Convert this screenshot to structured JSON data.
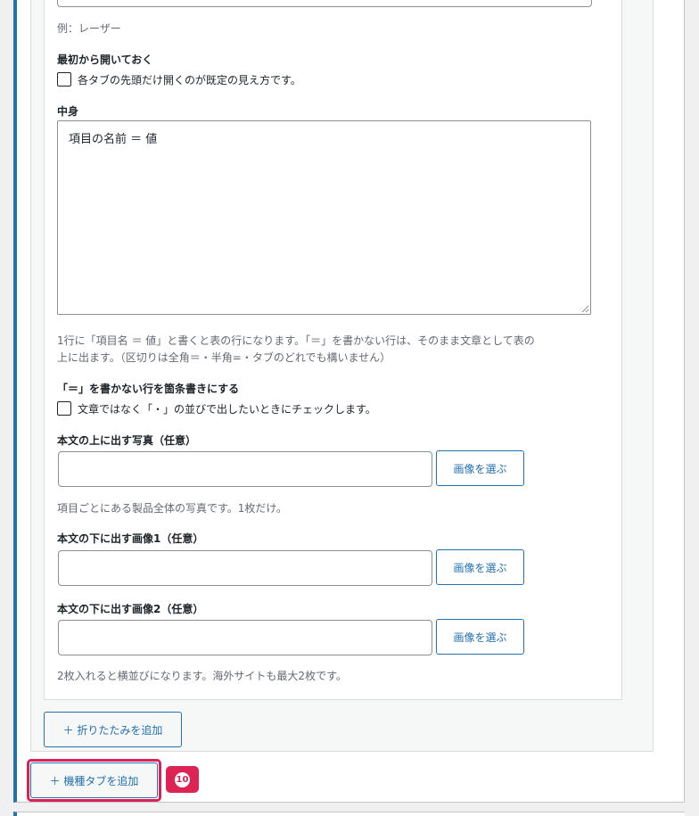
{
  "example_hint": "例：レーザー",
  "open_default": {
    "label": "最初から開いておく",
    "checkbox_text": "各タブの先頭だけ開くのが既定の見え方です。",
    "checked": false
  },
  "content": {
    "label": "中身",
    "value": "項目の名前 ＝ 値",
    "help_line1": "1行に「項目名 ＝ 値」と書くと表の行になります。「＝」を書かない行は、そのまま文章として表の",
    "help_line2": "上に出ます。（区切りは全角＝・半角=・タブのどれでも構いません）"
  },
  "bullets": {
    "label": "「＝」を書かない行を箇条書きにする",
    "checkbox_text": "文章ではなく「・」の並びで出したいときにチェックします。",
    "checked": false
  },
  "image_top": {
    "label": "本文の上に出す写真（任意）",
    "value": "",
    "button": "画像を選ぶ",
    "hint": "項目ごとにある製品全体の写真です。1枚だけ。"
  },
  "image_bottom1": {
    "label": "本文の下に出す画像1（任意）",
    "value": "",
    "button": "画像を選ぶ"
  },
  "image_bottom2": {
    "label": "本文の下に出す画像2（任意）",
    "value": "",
    "button": "画像を選ぶ",
    "hint": "2枚入れると横並びになります。海外サイトも最大2枚です。"
  },
  "add_fold_button": "＋ 折りたたみを追加",
  "add_tab_button": "＋ 機種タブを追加",
  "callout_number": "10",
  "colors": {
    "accent": "#2271b1",
    "highlight": "#d9215b",
    "badge": "#dc2353"
  }
}
